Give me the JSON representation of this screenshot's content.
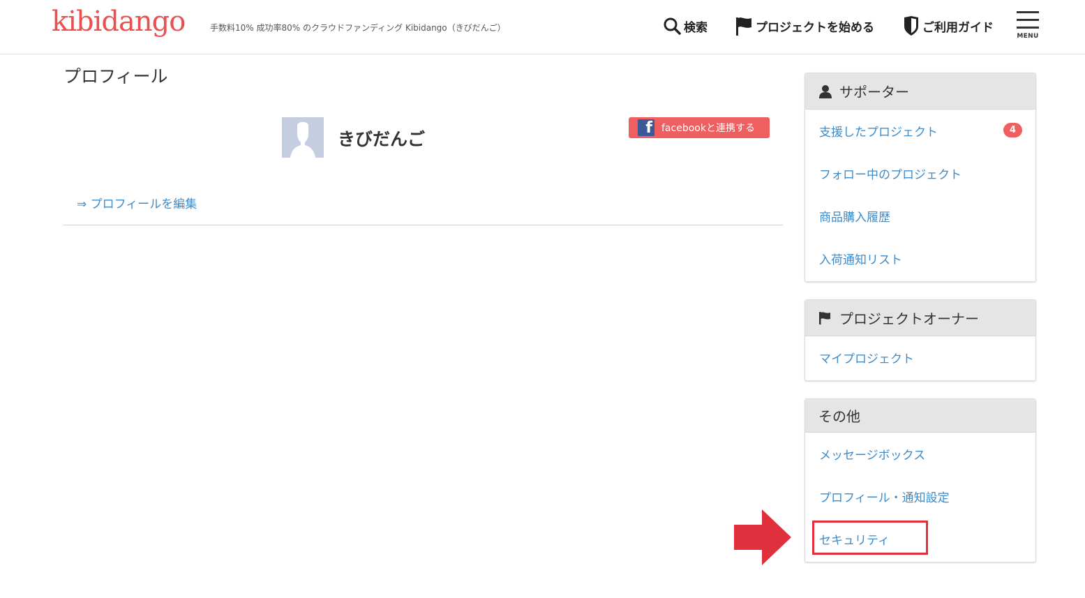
{
  "header": {
    "logo": "kibidango",
    "tagline": "手数料10% 成功率80% のクラウドファンディング Kibidango（きびだんご）",
    "nav": {
      "search": "検索",
      "start_project": "プロジェクトを始める",
      "guide": "ご利用ガイド",
      "menu": "MENU"
    }
  },
  "main": {
    "title": "プロフィール",
    "user_name": "きびだんご",
    "facebook_button": "facebookと連携する",
    "edit_link": "⇒ プロフィールを編集"
  },
  "sidebar": {
    "supporter": {
      "title": "サポーター",
      "items": [
        {
          "label": "支援したプロジェクト",
          "badge": "4"
        },
        {
          "label": "フォロー中のプロジェクト"
        },
        {
          "label": "商品購入履歴"
        },
        {
          "label": "入荷通知リスト"
        }
      ]
    },
    "owner": {
      "title": "プロジェクトオーナー",
      "items": [
        {
          "label": "マイプロジェクト"
        }
      ]
    },
    "other": {
      "title": "その他",
      "items": [
        {
          "label": "メッセージボックス"
        },
        {
          "label": "プロフィール・通知設定"
        },
        {
          "label": "セキュリティ"
        }
      ]
    }
  },
  "colors": {
    "brand": "#e8514f",
    "link": "#3d8bc9",
    "highlight": "#e0303e",
    "facebook": "#3b5998"
  }
}
